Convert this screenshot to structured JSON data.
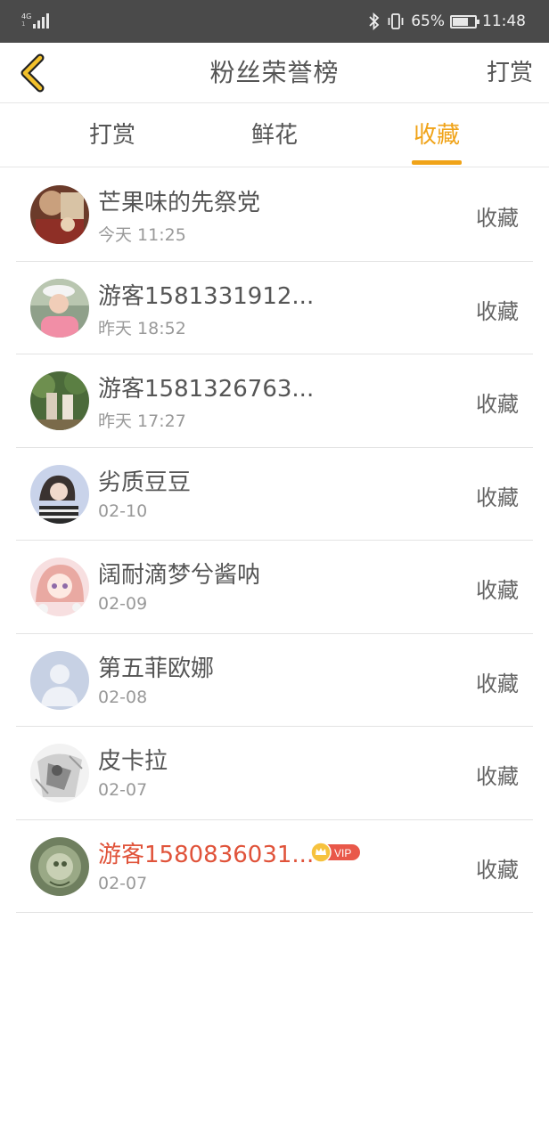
{
  "status_bar": {
    "network": "4G",
    "network_sub": "1",
    "battery": "65%",
    "battery_level": 0.65,
    "time": "11:48"
  },
  "header": {
    "title": "粉丝荣誉榜",
    "action": "打赏"
  },
  "tabs": [
    {
      "label": "打赏",
      "active": false
    },
    {
      "label": "鲜花",
      "active": false
    },
    {
      "label": "收藏",
      "active": true
    }
  ],
  "colors": {
    "accent": "#f0a318",
    "vip_name": "#e0533a",
    "status_bar_bg": "#4a4a4a"
  },
  "list": [
    {
      "name": "芒果味的先祭党",
      "time": "今天 11:25",
      "action": "收藏",
      "avatar": "avatar-photo-1"
    },
    {
      "name": "游客1581331912...",
      "time": "昨天 18:52",
      "action": "收藏",
      "avatar": "avatar-photo-2"
    },
    {
      "name": "游客1581326763...",
      "time": "昨天 17:27",
      "action": "收藏",
      "avatar": "avatar-photo-3"
    },
    {
      "name": "劣质豆豆",
      "time": "02-10",
      "action": "收藏",
      "avatar": "avatar-photo-4"
    },
    {
      "name": "阔耐滴梦兮酱呐",
      "time": "02-09",
      "action": "收藏",
      "avatar": "avatar-photo-5"
    },
    {
      "name": "第五菲欧娜",
      "time": "02-08",
      "action": "收藏",
      "avatar": "default-avatar-icon"
    },
    {
      "name": "皮卡拉",
      "time": "02-07",
      "action": "收藏",
      "avatar": "avatar-photo-7"
    },
    {
      "name": "游客1580836031...",
      "time": "02-07",
      "action": "收藏",
      "avatar": "avatar-photo-8",
      "vip": true,
      "vip_label": "VIP"
    }
  ]
}
